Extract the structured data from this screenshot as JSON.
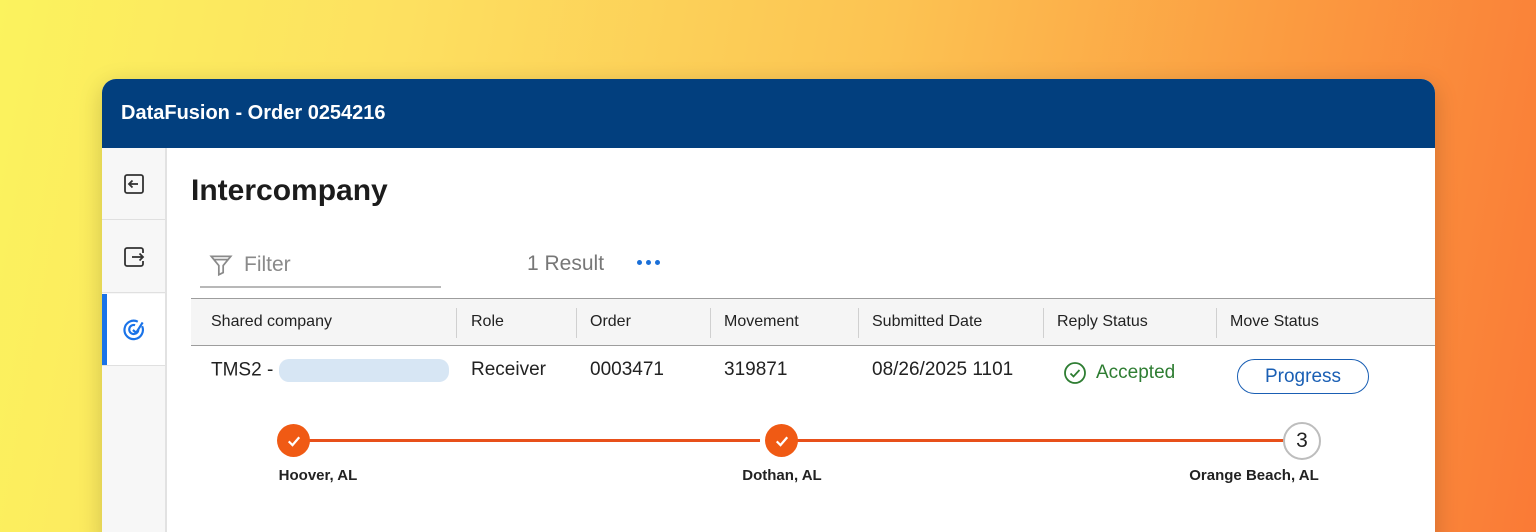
{
  "window": {
    "title": "DataFusion - Order 0254216"
  },
  "sidebar": {
    "items": [
      {
        "icon": "import-icon"
      },
      {
        "icon": "export-icon"
      },
      {
        "icon": "intercompany-icon",
        "active": true
      }
    ]
  },
  "page": {
    "title": "Intercompany"
  },
  "filter": {
    "placeholder": "Filter",
    "value": ""
  },
  "results": {
    "count_label": "1 Result"
  },
  "table": {
    "columns": [
      "Shared company",
      "Role",
      "Order",
      "Movement",
      "Submitted Date",
      "Reply Status",
      "Move Status"
    ],
    "rows": [
      {
        "shared_company": "TMS2 -",
        "role": "Receiver",
        "order": "0003471",
        "movement": "319871",
        "submitted_date": "08/26/2025 1101",
        "reply_status": "Accepted",
        "move_status": "Progress"
      }
    ]
  },
  "stops": [
    {
      "label": "Hoover, AL",
      "state": "complete"
    },
    {
      "label": "Dothan, AL",
      "state": "complete"
    },
    {
      "label": "Orange Beach, AL",
      "state": "pending",
      "number": "3"
    }
  ],
  "colors": {
    "titlebar": "#023f7e",
    "accent": "#1a73e8",
    "accepted": "#2e7d32",
    "stop_complete": "#f05a14"
  }
}
